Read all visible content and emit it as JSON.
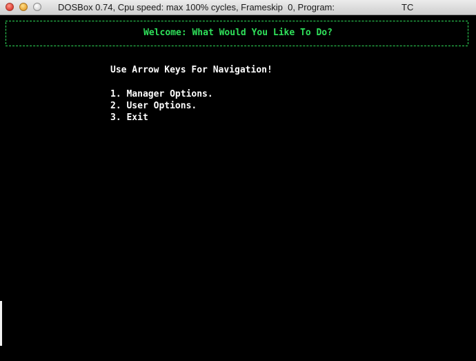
{
  "window": {
    "title": "DOSBox 0.74, Cpu speed: max 100% cycles, Frameskip  0, Program:",
    "program": "TC"
  },
  "screen": {
    "banner": "Welcome: What Would You Like To Do?",
    "hint": "Use Arrow Keys For Navigation!",
    "menu": [
      {
        "label": "1. Manager Options."
      },
      {
        "label": "2. User Options."
      },
      {
        "label": "3. Exit"
      }
    ]
  },
  "colors": {
    "banner_green": "#2fe05a",
    "text_white": "#ffffff",
    "background": "#000000"
  },
  "icons": [
    "close-icon",
    "minimize-icon",
    "zoom-icon"
  ]
}
